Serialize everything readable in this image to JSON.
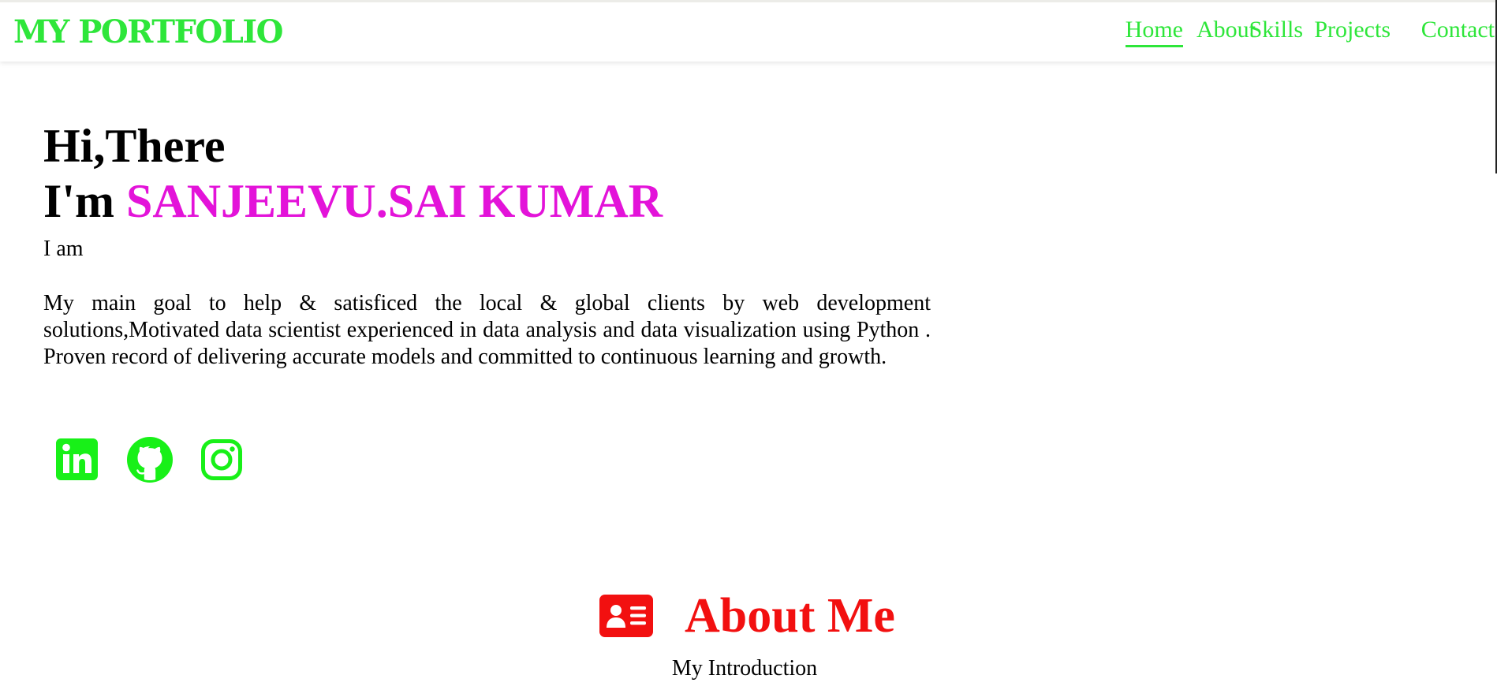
{
  "header": {
    "logo": "MY PORTFOLIO",
    "nav": [
      "Home",
      "About",
      "Skills",
      "Projects",
      "Contact"
    ],
    "active_nav": "Home"
  },
  "hero": {
    "greeting": "Hi,There",
    "intro_prefix": "I'm ",
    "name": "SANJEEVU.SAI KUMAR",
    "iam": "I am",
    "description": "My main goal to help & satisficed the local & global clients by web development solutions,Motivated data scientist experienced in data analysis and data visualization using Python . Proven record of delivering accurate models and committed to continuous learning and growth.",
    "socials": [
      "linkedin-icon",
      "github-icon",
      "instagram-icon"
    ]
  },
  "about": {
    "title": "About Me",
    "subtitle": "My Introduction",
    "icon": "id-card-icon"
  },
  "colors": {
    "accent_green": "#2ee63a",
    "social_green": "#18f018",
    "name_magenta": "#e313d9",
    "about_red": "#f21010"
  }
}
